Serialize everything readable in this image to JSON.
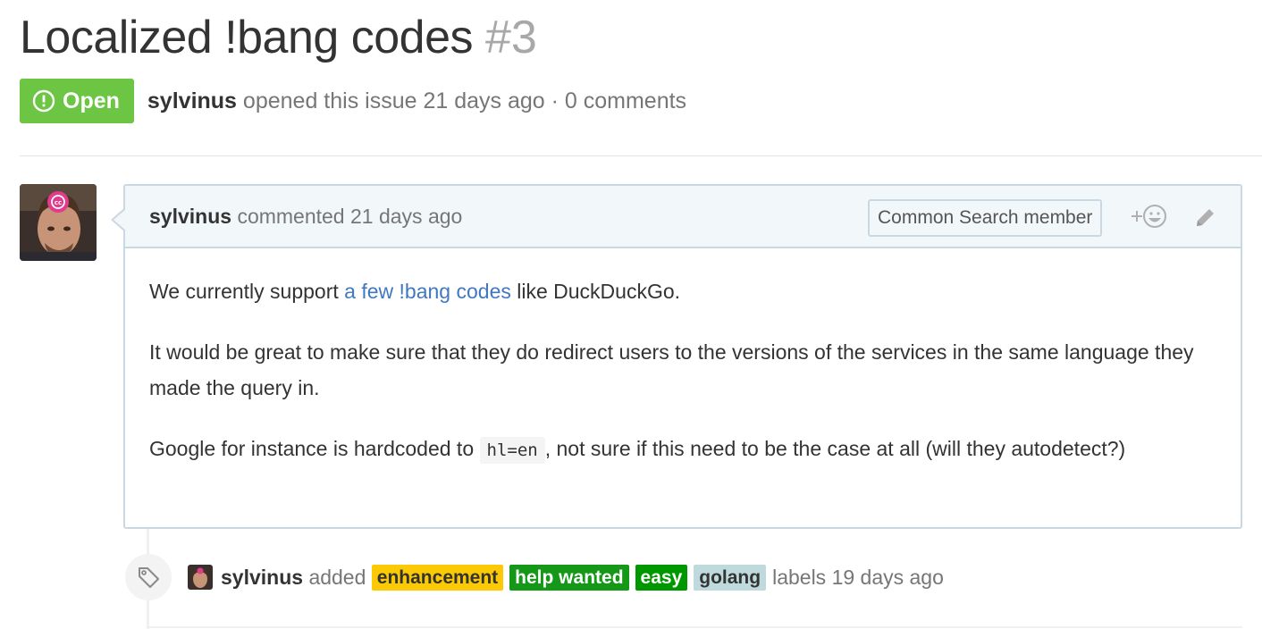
{
  "issue": {
    "title": "Localized !bang codes",
    "number": "#3",
    "state": "Open",
    "author": "sylvinus",
    "meta_text": "opened this issue 21 days ago · 0 comments"
  },
  "comment": {
    "author": "sylvinus",
    "action": "commented 21 days ago",
    "badge": "Common Search member",
    "body": {
      "p1_before": "We currently support ",
      "p1_link": "a few !bang codes",
      "p1_after": " like DuckDuckGo.",
      "p2": "It would be great to make sure that they do redirect users to the versions of the services in the same language they made the query in.",
      "p3_before": "Google for instance is hardcoded to ",
      "p3_code": "hl=en",
      "p3_after": ", not sure if this need to be the case at all (will they autodetect?)"
    }
  },
  "event": {
    "author": "sylvinus",
    "action": "added",
    "labels": [
      {
        "name": "enhancement",
        "color": "#fbca04"
      },
      {
        "name": "help wanted",
        "color": "#159818"
      },
      {
        "name": "easy",
        "color": "#009800"
      },
      {
        "name": "golang",
        "color": "#bfdadc"
      }
    ],
    "suffix": "labels 19 days ago"
  },
  "colors": {
    "open_green": "#6cc644",
    "link_blue": "#4078c0",
    "header_bg": "#f2f8fa",
    "border": "#cad8e3"
  },
  "icons": [
    "issue-opened-icon",
    "smiley-icon",
    "pencil-icon",
    "tag-icon"
  ]
}
